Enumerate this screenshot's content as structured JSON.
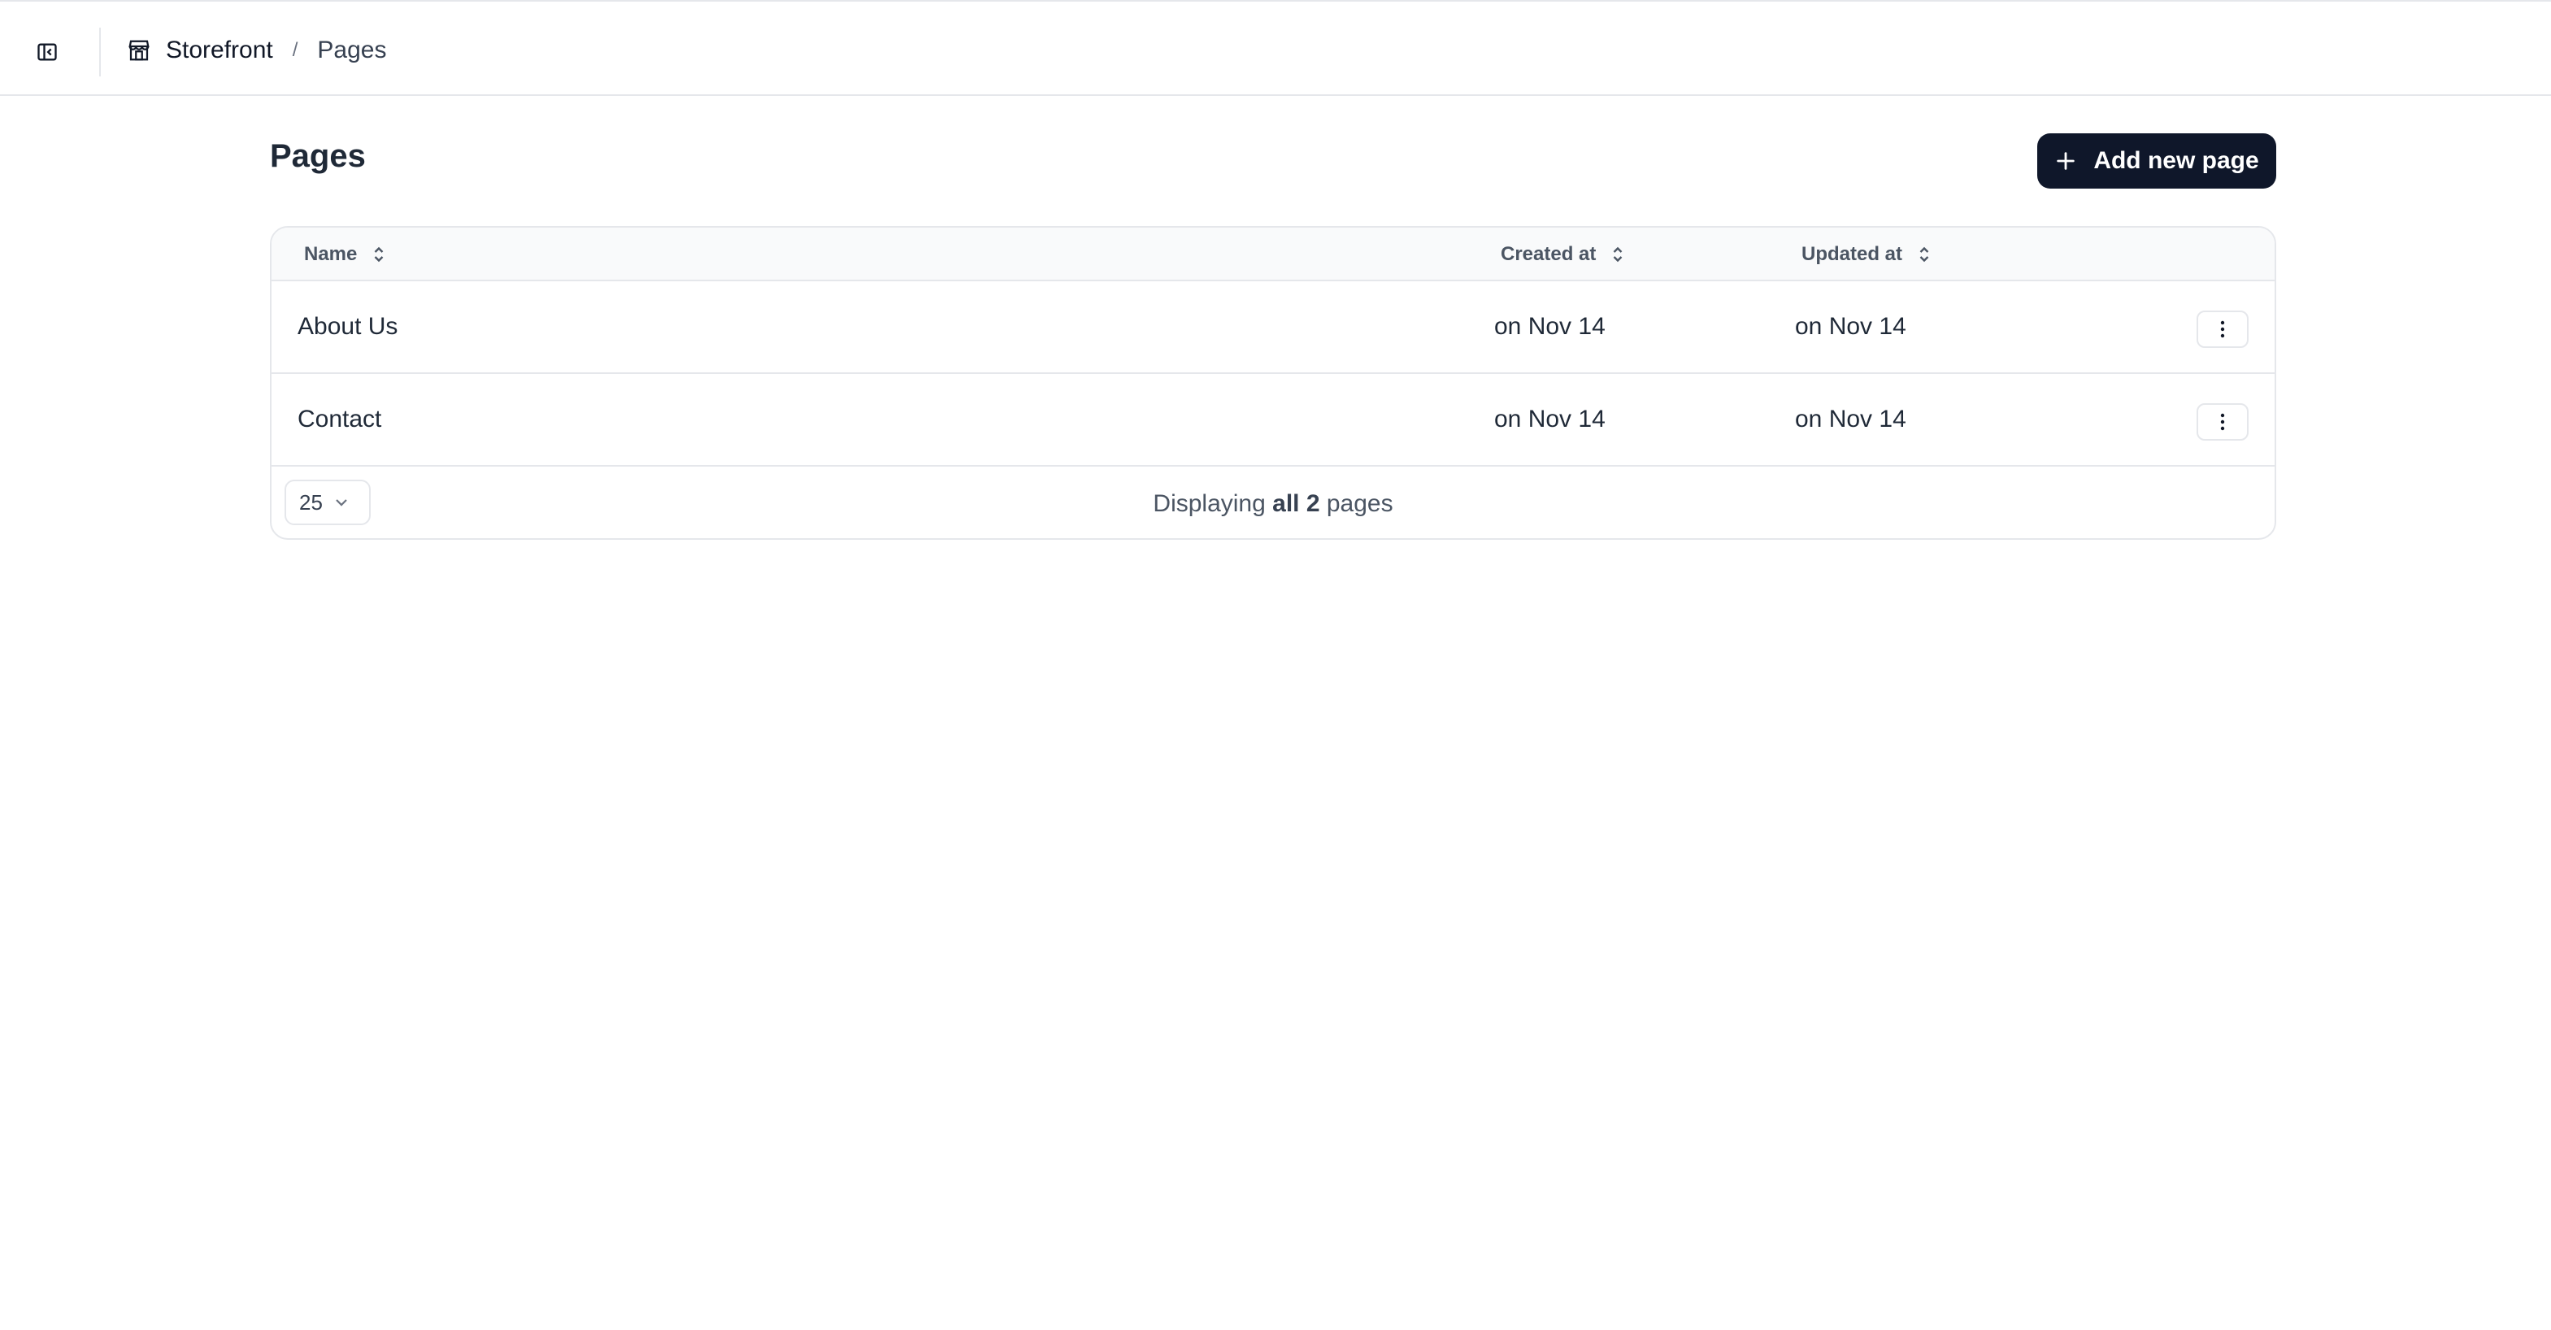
{
  "breadcrumb": {
    "store_label": "Storefront",
    "separator": "/",
    "current": "Pages"
  },
  "page": {
    "title": "Pages"
  },
  "actions": {
    "add_label": "Add new page"
  },
  "table": {
    "columns": {
      "name": "Name",
      "created": "Created at",
      "updated": "Updated at"
    },
    "rows": [
      {
        "name": "About Us",
        "created": "on Nov 14",
        "updated": "on Nov 14"
      },
      {
        "name": "Contact",
        "created": "on Nov 14",
        "updated": "on Nov 14"
      }
    ]
  },
  "footer": {
    "page_size": "25",
    "displaying_prefix": "Displaying ",
    "displaying_bold": "all 2",
    "displaying_suffix": " pages"
  },
  "icons": {
    "sidebar_toggle": "sidebar-toggle-icon",
    "store": "storefront-icon",
    "plus": "plus-icon",
    "sort": "sort-icon",
    "menu": "more-vertical-icon",
    "chevron": "chevron-down-icon"
  },
  "colors": {
    "primary_button": "#0f172a",
    "border": "#e5e7eb",
    "header_bg": "#f9fafb"
  }
}
